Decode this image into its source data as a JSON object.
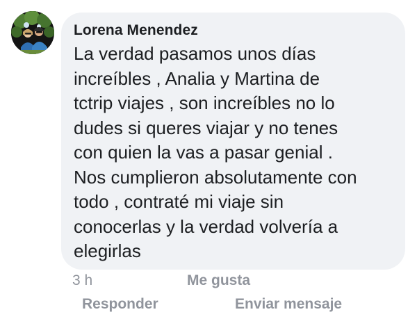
{
  "comment": {
    "author": "Lorena Menendez",
    "text_lines": [
      "La verdad pasamos unos días",
      "increíbles , Analia y Martina de",
      "tctrip viajes , son increíbles no lo",
      "dudes si queres viajar y no tenes",
      "con quien la vas a pasar genial .",
      "Nos cumplieron absolutamente con",
      "todo , contraté mi viaje sin",
      "conocerlas y la verdad volvería a",
      "elegirlas"
    ],
    "timestamp": "3 h",
    "like_label": "Me gusta"
  },
  "actions": {
    "reply_label": "Responder",
    "message_label": "Enviar mensaje"
  },
  "colors": {
    "bubble_bg": "#f0f2f5",
    "text": "#1c1e21",
    "meta_text": "#90949c"
  },
  "icons": {
    "avatar": "profile-photo-avatar"
  }
}
